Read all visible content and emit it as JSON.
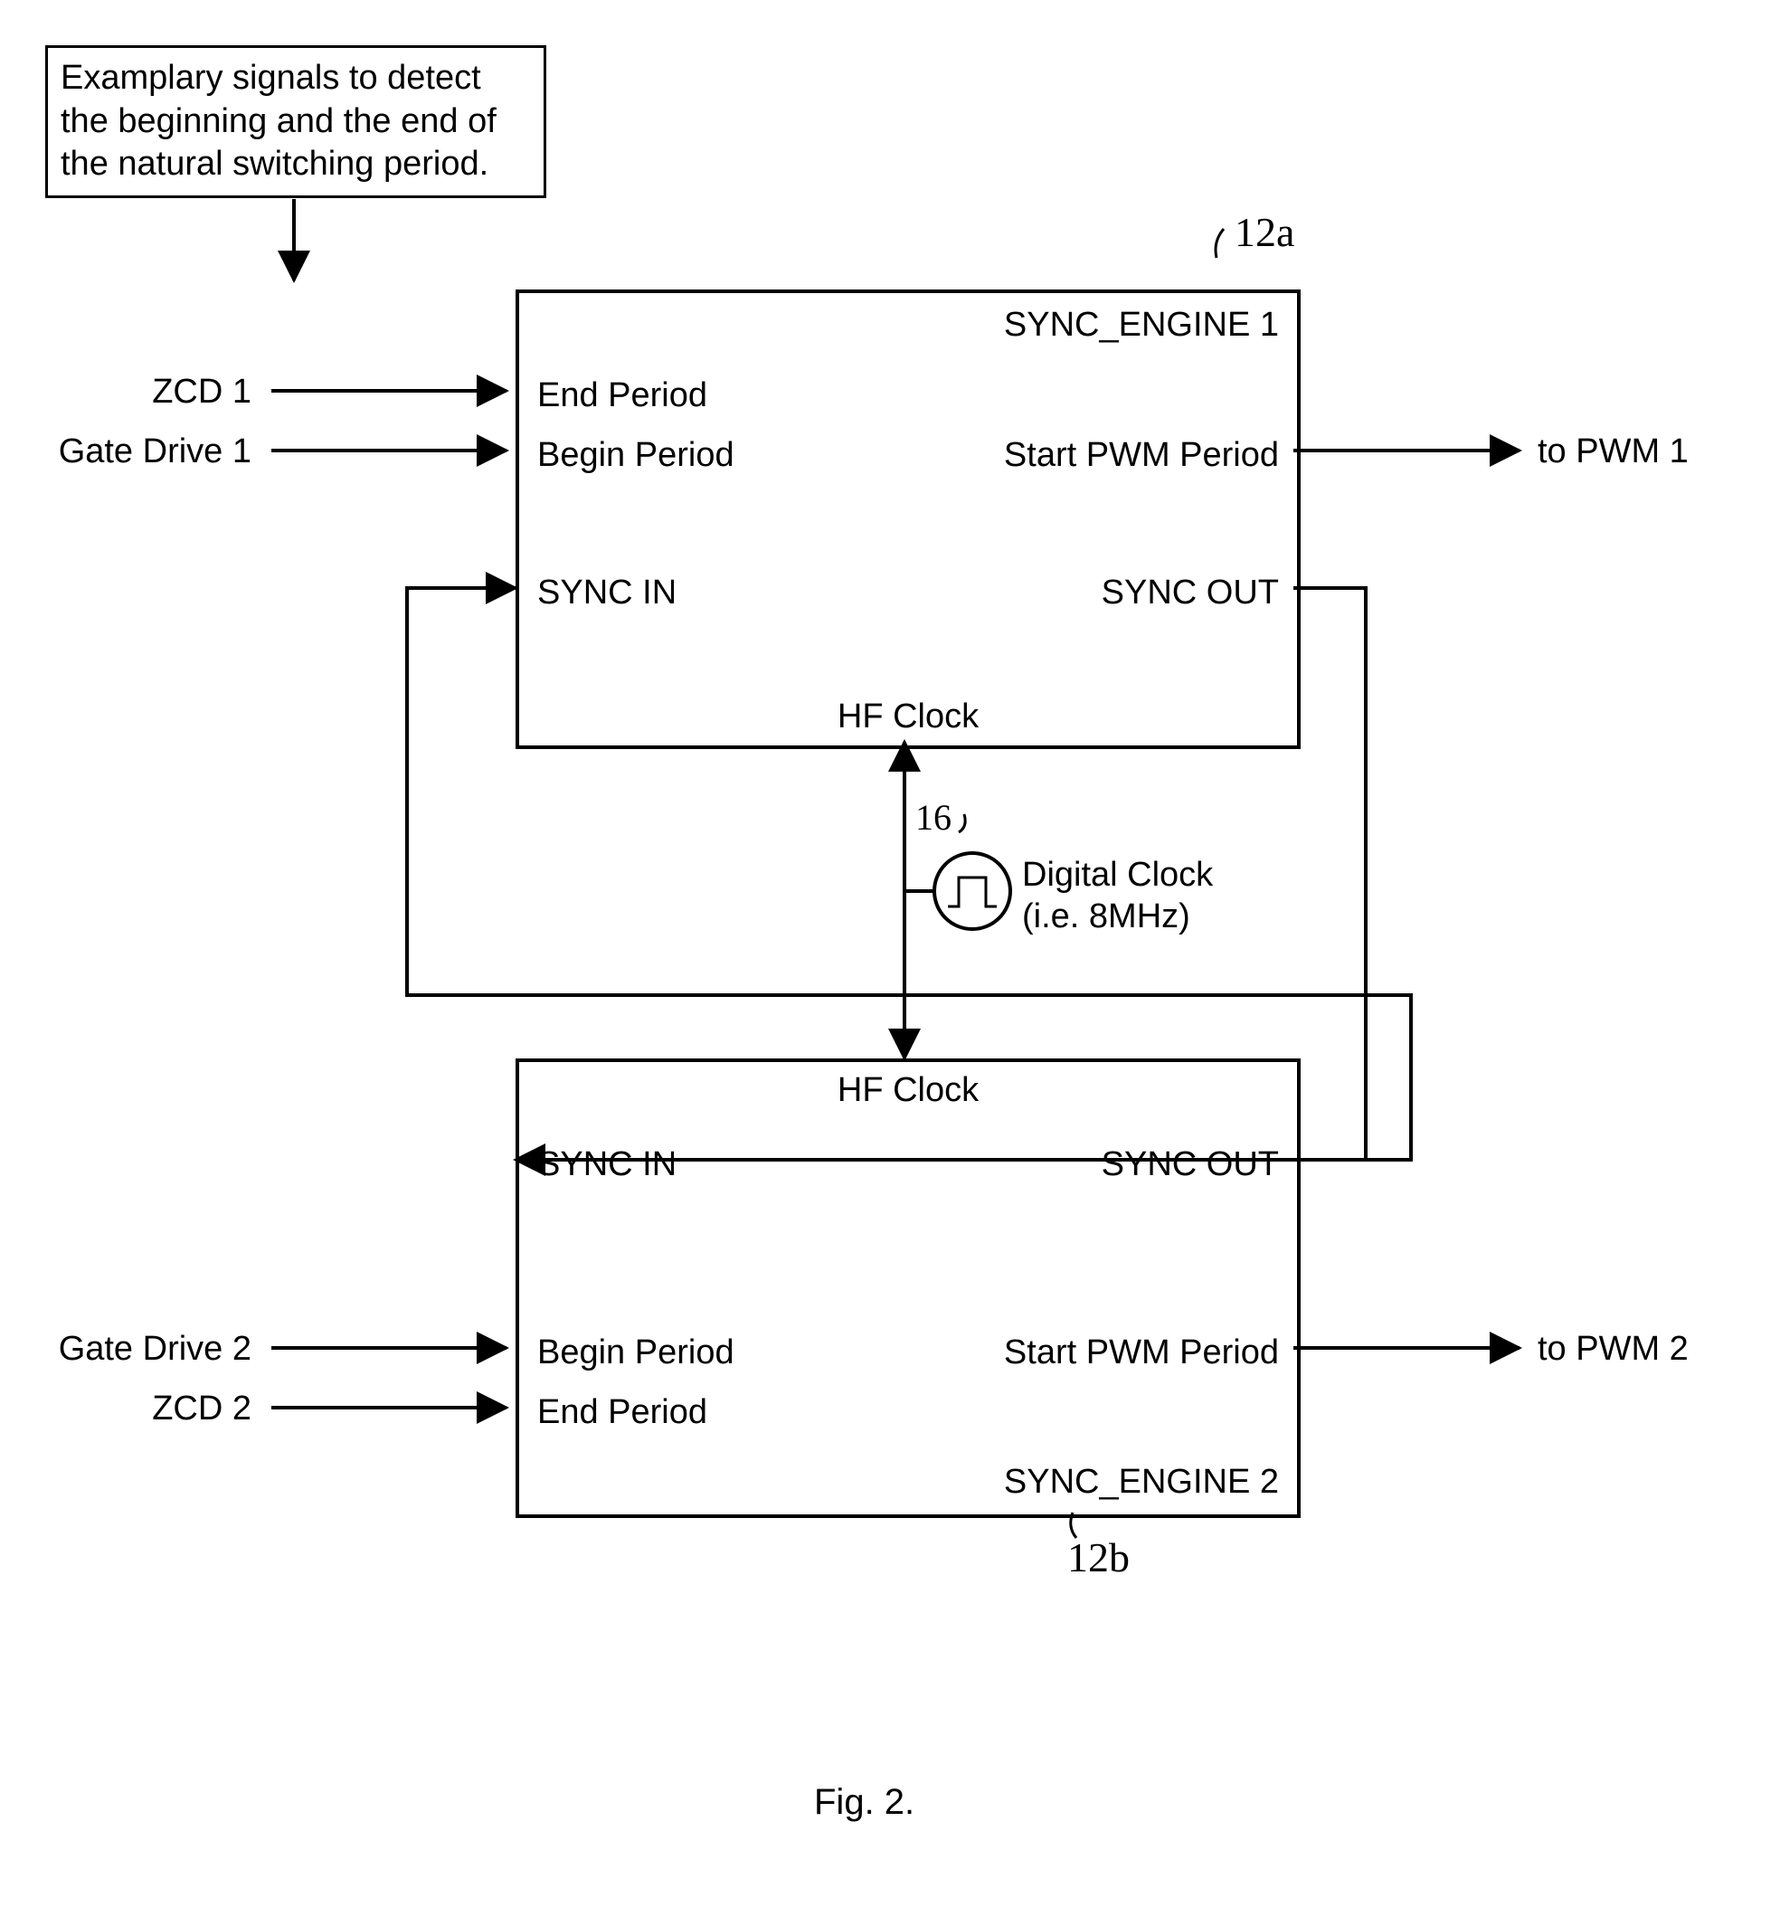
{
  "note": {
    "line1": "Examplary signals to detect",
    "line2": "the beginning and the end of",
    "line3": "the natural switching period."
  },
  "engine1": {
    "title": "SYNC_ENGINE 1",
    "end_period": "End Period",
    "begin_period": "Begin Period",
    "sync_in": "SYNC IN",
    "hf_clock": "HF Clock",
    "start_pwm": "Start PWM Period",
    "sync_out": "SYNC OUT",
    "ref": "12a"
  },
  "engine2": {
    "title": "SYNC_ENGINE 2",
    "end_period": "End Period",
    "begin_period": "Begin Period",
    "sync_in": "SYNC IN",
    "hf_clock": "HF Clock",
    "start_pwm": "Start PWM Period",
    "sync_out": "SYNC OUT",
    "ref": "12b"
  },
  "inputs": {
    "zcd1": "ZCD 1",
    "gate_drive1": "Gate Drive 1",
    "zcd2": "ZCD 2",
    "gate_drive2": "Gate Drive 2"
  },
  "outputs": {
    "pwm1": "to PWM 1",
    "pwm2": "to PWM 2"
  },
  "clock": {
    "label1": "Digital Clock",
    "label2": "(i.e. 8MHz)",
    "ref": "16"
  },
  "caption": "Fig. 2."
}
